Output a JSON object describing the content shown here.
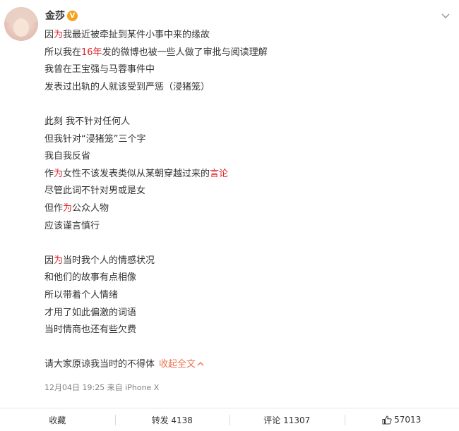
{
  "user": {
    "name": "金莎",
    "badge": "V"
  },
  "post": {
    "lines": [
      [
        {
          "t": "因"
        },
        {
          "t": "为",
          "red": true
        },
        {
          "t": "我最近被牵扯到某件小事中来的缘故"
        }
      ],
      [
        {
          "t": "所以我在"
        },
        {
          "t": "16年",
          "red": true
        },
        {
          "t": "发的微博也被一些人做了审批与阅读理解"
        }
      ],
      [
        {
          "t": "我曾在王宝强与马蓉事件中"
        }
      ],
      [
        {
          "t": "发表过出轨的人就该受到严惩（浸猪笼）"
        }
      ],
      [],
      [
        {
          "t": "此刻 我不针对任何人"
        }
      ],
      [
        {
          "t": "但我针对“浸猪笼”三个字"
        }
      ],
      [
        {
          "t": "我自我反省"
        }
      ],
      [
        {
          "t": "作"
        },
        {
          "t": "为",
          "red": true
        },
        {
          "t": "女性不该发表类似从某朝穿越过来的"
        },
        {
          "t": "言论",
          "red": true
        }
      ],
      [
        {
          "t": "尽管此词不针对男或是女"
        }
      ],
      [
        {
          "t": "但作"
        },
        {
          "t": "为",
          "red": true
        },
        {
          "t": "公众人物"
        }
      ],
      [
        {
          "t": "应该谨言慎行"
        }
      ],
      [],
      [
        {
          "t": "因"
        },
        {
          "t": "为",
          "red": true
        },
        {
          "t": "当时我个人的情感状况"
        }
      ],
      [
        {
          "t": "和他们的故事有点相像"
        }
      ],
      [
        {
          "t": "所以带着个人情绪"
        }
      ],
      [
        {
          "t": "才用了如此偏激的词语"
        }
      ],
      [
        {
          "t": "当时情商也还有些欠费"
        }
      ],
      [],
      [
        {
          "t": "请大家原谅我当时的不得体"
        }
      ]
    ],
    "collapse_label": "收起全文",
    "meta": "12月04日 19:25 来自 iPhone X"
  },
  "actions": {
    "favorite": "收藏",
    "repost": "转发 4138",
    "comment": "评论 11307",
    "like": "57013"
  },
  "colors": {
    "highlight": "#e0212b",
    "link": "#eb7350",
    "badge": "#f7a21c"
  }
}
